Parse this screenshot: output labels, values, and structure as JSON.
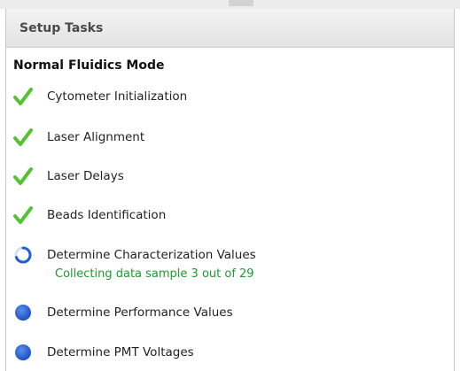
{
  "panel": {
    "title": "Setup Tasks"
  },
  "mode_title": "Normal Fluidics Mode",
  "tasks": [
    {
      "label": "Cytometer Initialization",
      "state": "done",
      "icon": "checkmark-icon"
    },
    {
      "label": "Laser Alignment",
      "state": "done",
      "icon": "checkmark-icon"
    },
    {
      "label": "Laser Delays",
      "state": "done",
      "icon": "checkmark-icon"
    },
    {
      "label": "Beads Identification",
      "state": "done",
      "icon": "checkmark-icon"
    },
    {
      "label": "Determine Characterization Values",
      "state": "in-progress",
      "icon": "spinner-icon",
      "status": "Collecting data sample 3 out of 29"
    },
    {
      "label": "Determine Performance Values",
      "state": "pending",
      "icon": "blue-dot-icon"
    },
    {
      "label": "Determine PMT Voltages",
      "state": "pending",
      "icon": "blue-dot-icon"
    }
  ],
  "colors": {
    "check": "#55c232",
    "pending_dot": "#1f5fd6",
    "status_text": "#1f9a2b"
  }
}
